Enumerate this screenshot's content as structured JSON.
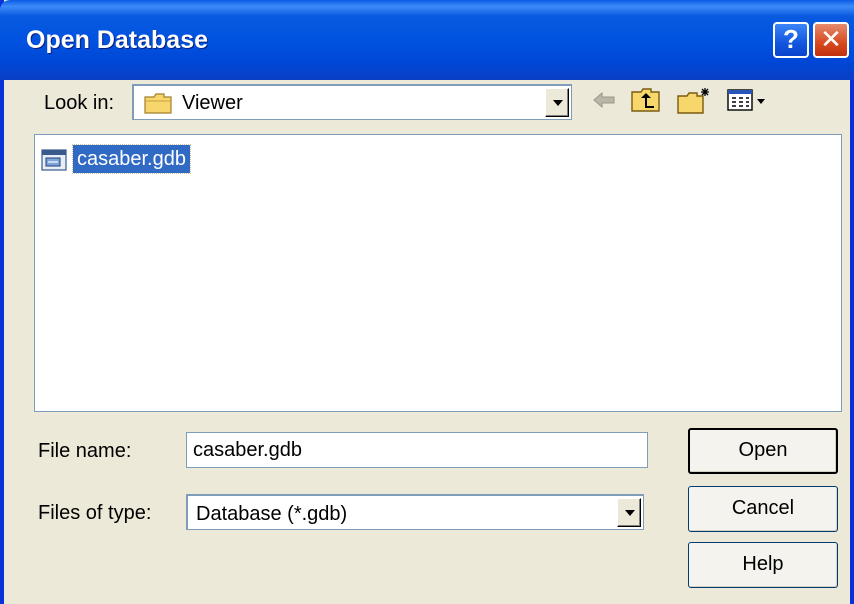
{
  "dialog": {
    "title": "Open Database",
    "help_button": "?",
    "close_button": "✕"
  },
  "look_in": {
    "label": "Look in:",
    "value": "Viewer",
    "folder_icon": "folder-icon"
  },
  "toolbar": {
    "icons": [
      "back-icon",
      "up-one-level-icon",
      "create-new-folder-icon",
      "view-menu-icon"
    ]
  },
  "file_list": {
    "items": [
      {
        "name": "casaber.gdb",
        "icon": "database-file-icon",
        "selected": true
      }
    ]
  },
  "form": {
    "file_name_label": "File name:",
    "file_name_value": "casaber.gdb",
    "files_of_type_label": "Files of type:",
    "files_of_type_value": "Database (*.gdb)"
  },
  "buttons": {
    "open": "Open",
    "cancel": "Cancel",
    "help": "Help"
  },
  "colors": {
    "title_bar": "#0053e0",
    "selection": "#316ac5",
    "dialog_bg": "#ece9d8"
  }
}
